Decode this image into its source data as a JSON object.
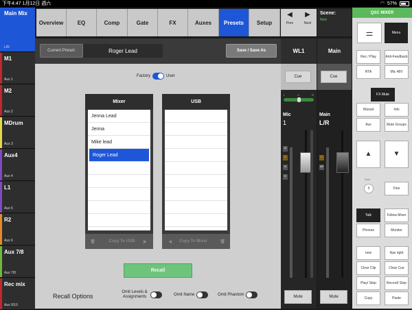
{
  "status": {
    "time": "下午4:47",
    "date": "1月12日 週六",
    "battery": "57%"
  },
  "mixes": [
    {
      "name": "Main Mix",
      "sub": "L/R",
      "color": "#1e56d8",
      "selected": true
    },
    {
      "name": "M1",
      "sub": "Aux 1",
      "color": "#c0282d"
    },
    {
      "name": "M2",
      "sub": "Aux 2",
      "color": "#c0282d"
    },
    {
      "name": "MDrum",
      "sub": "Aux 3",
      "color": "#e4d84a"
    },
    {
      "name": "Aux4",
      "sub": "Aux 4",
      "color": "#7f4ac2"
    },
    {
      "name": "L1",
      "sub": "Aux 5",
      "color": "#7f4ac2"
    },
    {
      "name": "R2",
      "sub": "Aux 6",
      "color": "#e28a2a"
    },
    {
      "name": "Aux 7/8",
      "sub": "Aux 7/8",
      "color": "#6fb93e"
    },
    {
      "name": "Rec mix",
      "sub": "Aux 9/10",
      "color": "#c0282d"
    }
  ],
  "tabs": [
    "Overview",
    "EQ",
    "Comp",
    "Gate",
    "FX",
    "Auxes",
    "Presets",
    "Setup"
  ],
  "nav": {
    "prev": "Prev",
    "next": "Next"
  },
  "preset": {
    "label": "Current Preset:",
    "name": "Roger Lead",
    "save": "Save / Save As"
  },
  "source_toggle": {
    "left": "Factory",
    "right": "User"
  },
  "mixer_list": {
    "title": "Mixer",
    "items": [
      "Jenna Lead",
      "Jenna",
      "Mike lead",
      "Roger Lead"
    ],
    "selected": 3,
    "action": "Copy To USB"
  },
  "usb_list": {
    "title": "USB",
    "items": [],
    "action": "Copy To Mixer"
  },
  "recall": "Recall",
  "recall_options": {
    "title": "Recall Options",
    "omit_levels": "Omit Levels & Assignments",
    "omit_name": "Omit Name",
    "omit_phantom": "Omit Phantom"
  },
  "scene": {
    "label": "Scene:",
    "state": "New"
  },
  "strip_wl1": {
    "title": "WL1",
    "cue": "Cue",
    "channel": "Mic",
    "num": "1",
    "mute": "Mute"
  },
  "strip_main": {
    "title": "Main",
    "cue": "Cue",
    "channel": "Main",
    "num": "L/R",
    "mute": "Mute"
  },
  "right_panel": {
    "title": "QSC MIXER",
    "menu": "Menu",
    "rec_play": "Rec / Play",
    "anti_feedback": "Anti-Feedback",
    "rta": "RTA",
    "mic48v": "Mic 48V",
    "fx_mute": "FX Mute",
    "wizard": "Wizard",
    "info": "Info",
    "aux": "Aux",
    "mute_groups": "Mute Groups",
    "zero": "Zero",
    "zero_val": "0",
    "fine": "Fine",
    "talk": "Talk",
    "follow_mixer": "Follow Mixer",
    "phones": "Phones",
    "monitor": "Monitor",
    "new": "new",
    "nav_right": "Nav right",
    "clear_clip": "Clear Clip",
    "clear_cue": "Clear Cue",
    "play_stop": "Play/ Stop",
    "record_stop": "Record/ Stop",
    "copy": "Copy",
    "paste": "Paste"
  }
}
